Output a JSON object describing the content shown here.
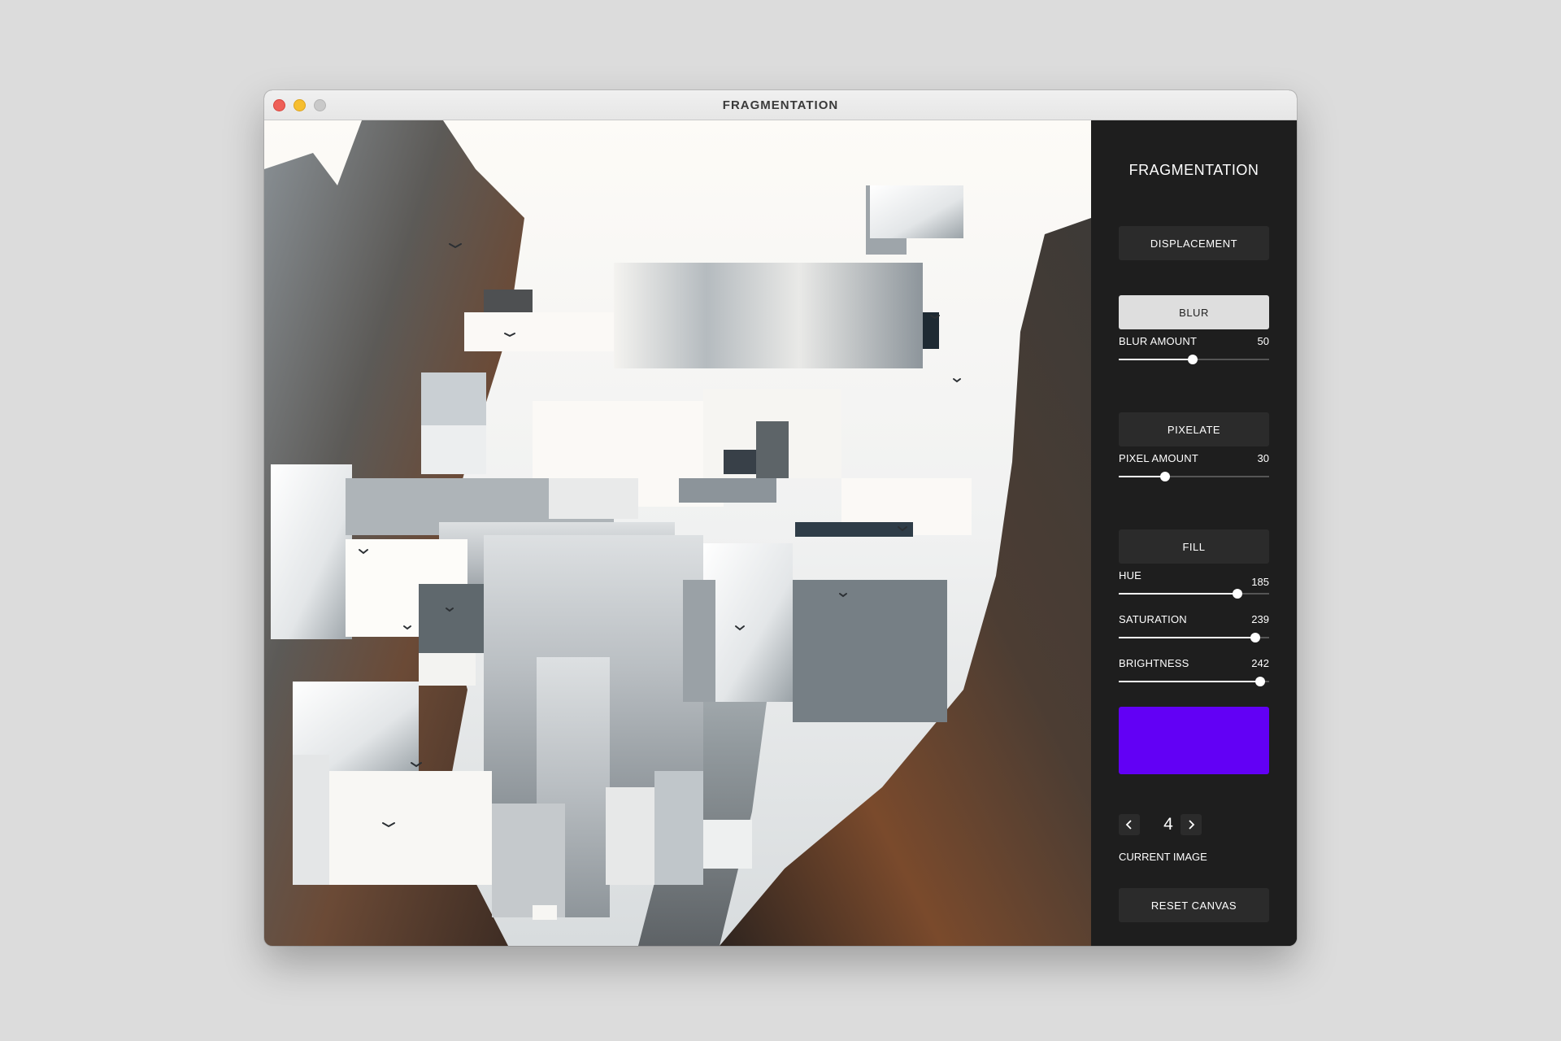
{
  "window": {
    "title": "FRAGMENTATION"
  },
  "panel": {
    "title": "FRAGMENTATION",
    "displacement_label": "DISPLACEMENT",
    "blur_label": "BLUR",
    "blur_amount": {
      "label": "BLUR AMOUNT",
      "value": "50",
      "fraction": 0.49
    },
    "pixelate_label": "PIXELATE",
    "pixel_amount": {
      "label": "PIXEL AMOUNT",
      "value": "30",
      "fraction": 0.31
    },
    "fill_label": "FILL",
    "hue": {
      "label": "HUE",
      "value": "185",
      "fraction": 0.79
    },
    "saturation": {
      "label": "SATURATION",
      "value": "239",
      "fraction": 0.91
    },
    "brightness": {
      "label": "BRIGHTNESS",
      "value": "242",
      "fraction": 0.94
    },
    "fill_color": "#6200f5",
    "current_image": {
      "value": "4",
      "label": "CURRENT IMAGE"
    },
    "reset_label": "RESET CANVAS",
    "active_button": "blur"
  },
  "icons": {
    "prev": "chevron-left-icon",
    "next": "chevron-right-icon"
  },
  "colors": {
    "panel_bg": "#1e1e1e",
    "button_bg": "#2b2b2b",
    "active_button_bg": "#dedede",
    "fill_swatch": "#6200f5"
  }
}
